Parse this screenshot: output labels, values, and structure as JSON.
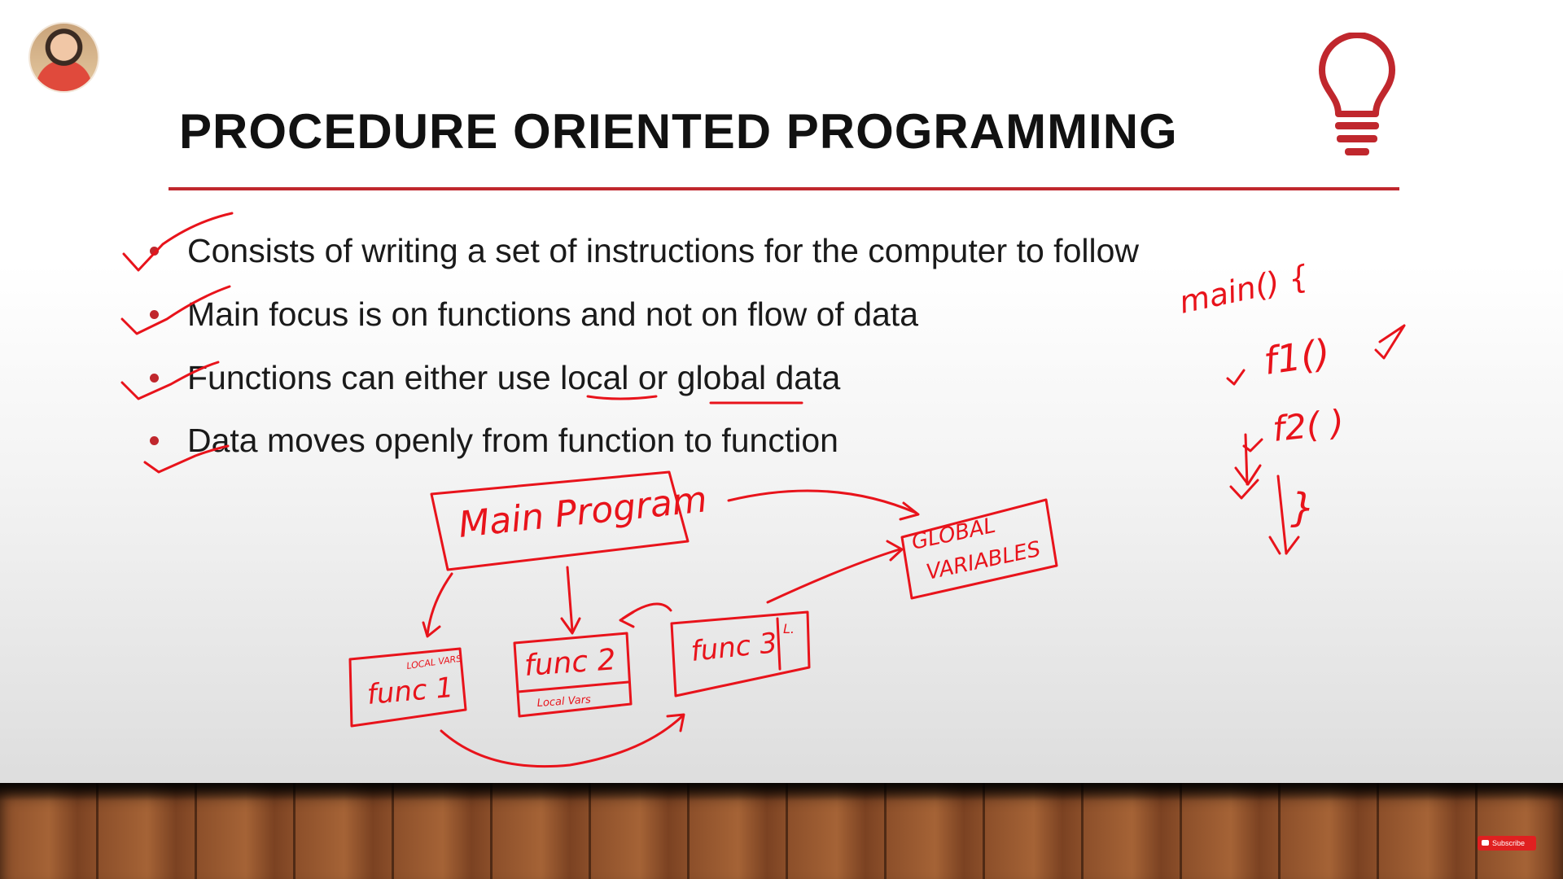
{
  "slide": {
    "title": "PROCEDURE ORIENTED PROGRAMMING",
    "accent_color": "#c0272d",
    "bullets": [
      {
        "parts": [
          "Consists of writing a set of instructions for the computer to follow"
        ]
      },
      {
        "parts": [
          "Main focus is on functions and not on flow of data"
        ]
      },
      {
        "parts": [
          "Functions can either use ",
          "local",
          " or ",
          "global",
          " data"
        ]
      },
      {
        "parts": [
          "Data moves openly from function to function"
        ]
      }
    ]
  },
  "annotations": {
    "ink_color": "#e8131b",
    "diagram": {
      "main_program": "Main Program",
      "global_variables_line1": "GLOBAL",
      "global_variables_line2": "VARIABLES",
      "func1": "func 1",
      "func1_local": "LOCAL VARS",
      "func2": "func 2",
      "func2_local": "Local Vars",
      "func3": "func 3",
      "func3_local": "L."
    },
    "code_sketch": {
      "main": "main() {",
      "f1": "f1()",
      "f2": "f2( )",
      "close": "}"
    }
  },
  "icons": {
    "bulb": "lightbulb-icon",
    "avatar": "presenter-avatar"
  },
  "subscribe_label": "Subscribe"
}
